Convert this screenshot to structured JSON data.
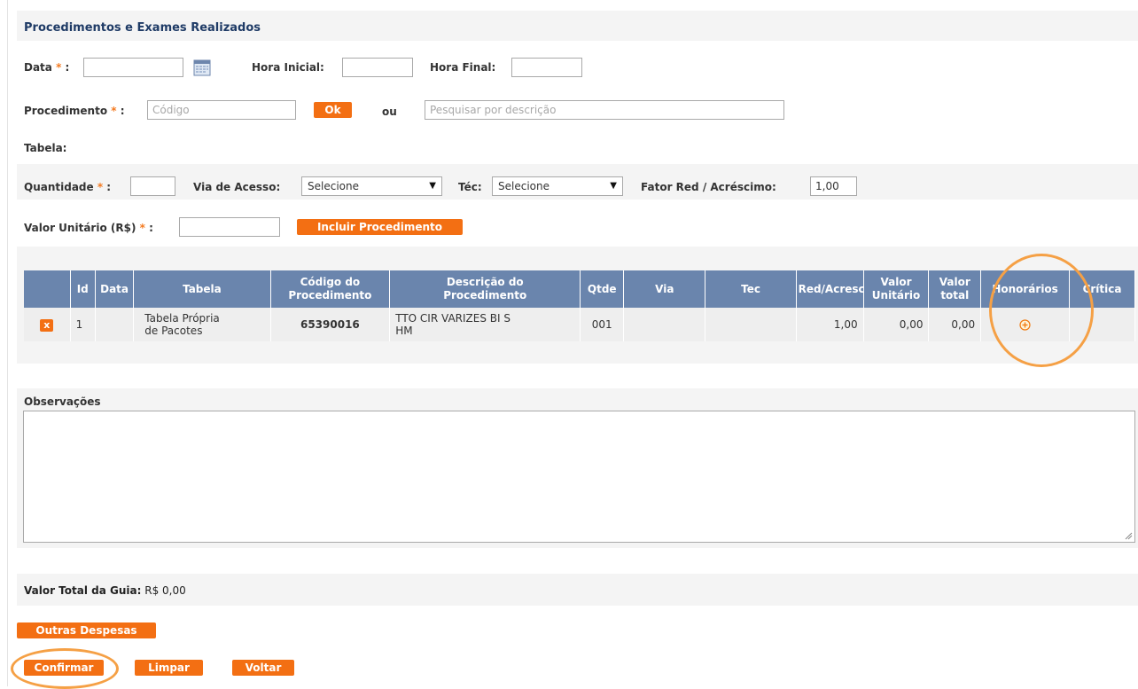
{
  "section_title": "Procedimentos e Exames Realizados",
  "required_mark": "*",
  "form": {
    "data_label": "Data",
    "data_value": "",
    "hora_inicial_label": "Hora Inicial:",
    "hora_inicial_value": "",
    "hora_final_label": "Hora Final:",
    "hora_final_value": "",
    "procedimento_label": "Procedimento",
    "codigo_placeholder": "Código",
    "ok_label": "Ok",
    "ou_label": "ou",
    "descricao_placeholder": "Pesquisar por descrição",
    "tabela_label": "Tabela:",
    "quantidade_label": "Quantidade",
    "quantidade_value": "",
    "via_acesso_label": "Via de Acesso:",
    "via_acesso_selected": "Selecione",
    "tec_label": "Téc:",
    "tec_selected": "Selecione",
    "fator_label": "Fator Red / Acréscimo:",
    "fator_value": "1,00",
    "valor_unitario_label": "Valor Unitário (R$)",
    "valor_unitario_value": "",
    "incluir_label": "Incluir Procedimento"
  },
  "table": {
    "headers": {
      "id": "Id",
      "data": "Data",
      "tabela": "Tabela",
      "codigo_1": "Código do",
      "codigo_2": "Procedimento",
      "descricao_1": "Descrição do",
      "descricao_2": "Procedimento",
      "qtde": "Qtde",
      "via": "Via",
      "tec": "Tec",
      "red_acresc": "Red/Acresc",
      "valor_unitario_1": "Valor",
      "valor_unitario_2": "Unitário",
      "valor_total_1": "Valor",
      "valor_total_2": "total",
      "honorarios": "Honorários",
      "critica": "Crítica"
    },
    "rows": [
      {
        "delete_label": "x",
        "id": "1",
        "data": "",
        "tabela_1": "Tabela Própria",
        "tabela_2": "de Pacotes",
        "codigo": "65390016",
        "descricao_1": "TTO CIR VARIZES BI S",
        "descricao_2": "HM",
        "qtde": "001",
        "via": "",
        "tec": "",
        "red_acresc": "1,00",
        "valor_unitario": "0,00",
        "valor_total": "0,00",
        "honorarios_icon": "plus-circle-icon",
        "critica": ""
      }
    ]
  },
  "observacoes": {
    "label": "Observações",
    "value": ""
  },
  "valor_total": {
    "label": "Valor Total da Guia:",
    "value": "R$ 0,00"
  },
  "buttons": {
    "outras_despesas": "Outras Despesas",
    "confirmar": "Confirmar",
    "limpar": "Limpar",
    "voltar": "Voltar"
  },
  "colors": {
    "accent": "#f36f13",
    "header_bg": "#6a85ad",
    "title": "#1f3b66",
    "highlight_ring": "#f5a045"
  }
}
